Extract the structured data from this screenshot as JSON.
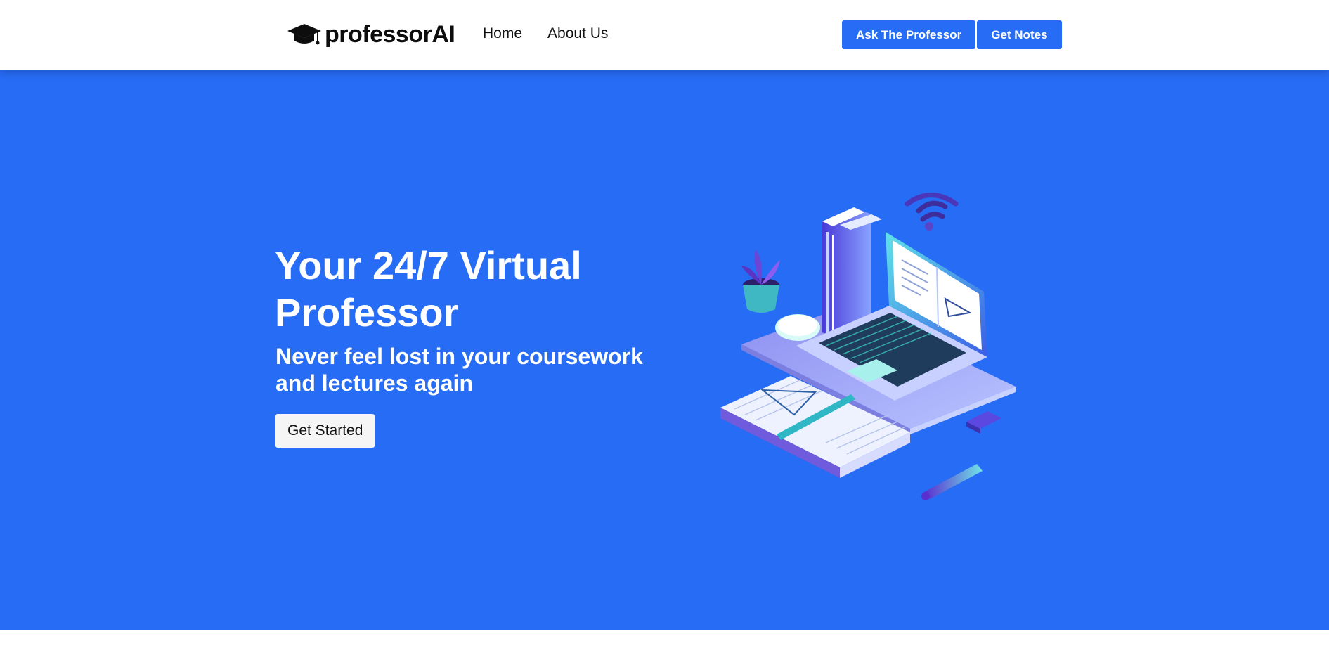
{
  "navbar": {
    "logo_text": "professorAI",
    "links": [
      {
        "label": "Home"
      },
      {
        "label": "About Us"
      }
    ],
    "actions": [
      {
        "label": "Ask The Professor"
      },
      {
        "label": "Get Notes"
      }
    ]
  },
  "hero": {
    "title": "Your 24/7 Virtual Professor",
    "subtitle": "Never feel lost in your coursework and lectures again",
    "cta_label": "Get Started",
    "illustration_icon": "laptop-books-study-illustration"
  },
  "colors": {
    "accent": "#276cf5",
    "nav_bg": "#ffffff",
    "text_dark": "#111111",
    "text_light": "#ffffff"
  }
}
